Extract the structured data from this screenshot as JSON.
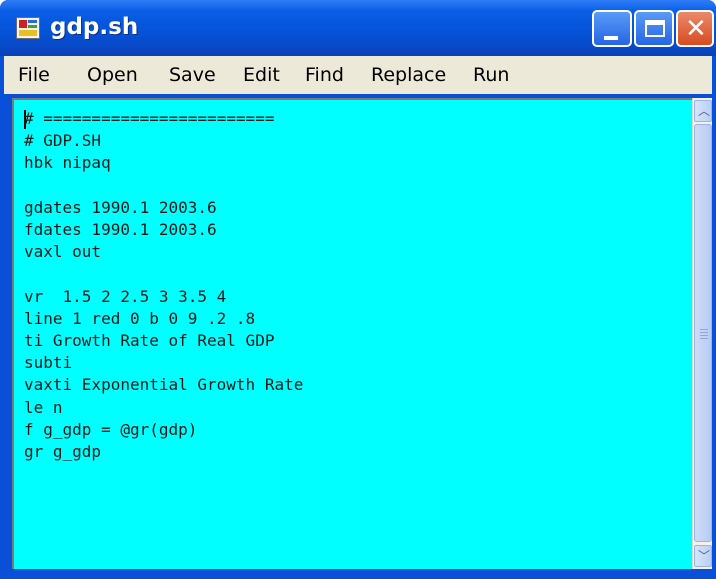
{
  "window": {
    "title": "gdp.sh",
    "controls": {
      "minimize_icon": "minimize-icon",
      "maximize_icon": "maximize-icon",
      "close_icon": "close-icon"
    }
  },
  "menu": {
    "items": [
      "File",
      "Open",
      "Save",
      "Edit",
      "Find",
      "Replace",
      "Run"
    ]
  },
  "editor": {
    "background_color": "#00ffff",
    "lines": [
      "# ========================",
      "# GDP.SH",
      "hbk nipaq",
      "",
      "gdates 1990.1 2003.6",
      "fdates 1990.1 2003.6",
      "vaxl out",
      "",
      "vr  1.5 2 2.5 3 3.5 4",
      "line 1 red 0 b 0 9 .2 .8",
      "ti Growth Rate of Real GDP",
      "subti",
      "vaxti Exponential Growth Rate",
      "le n",
      "f g_gdp = @gr(gdp)",
      "gr g_gdp"
    ]
  }
}
